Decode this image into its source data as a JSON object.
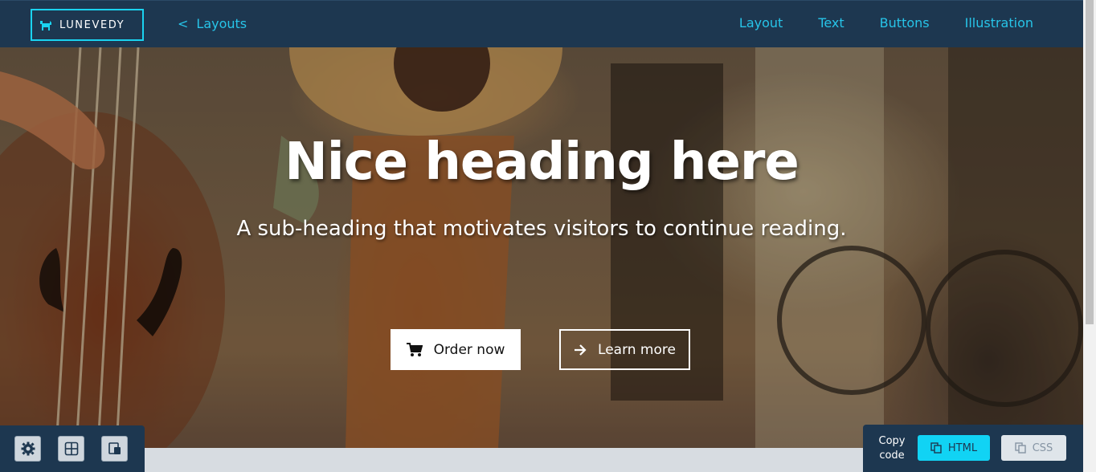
{
  "brand": {
    "name": "LUNEVEDY",
    "logo_icon": "dog-logo-icon"
  },
  "back_link": {
    "chevron": "<",
    "label": "Layouts"
  },
  "nav": {
    "items": [
      "Layout",
      "Text",
      "Buttons",
      "Illustration"
    ]
  },
  "hero": {
    "heading": "Nice heading here",
    "subheading": "A sub-heading that motivates visitors to continue reading.",
    "primary_button": {
      "label": "Order now",
      "icon": "cart-icon"
    },
    "secondary_button": {
      "label": "Learn more",
      "icon": "arrow-right-icon"
    }
  },
  "toolbar": {
    "items": [
      "gear-icon",
      "grid-icon",
      "layers-icon"
    ]
  },
  "copy_panel": {
    "label": "Copy code",
    "html_label": "HTML",
    "css_label": "CSS"
  },
  "colors": {
    "accent": "#11d3f4",
    "nav_background": "#1d3750",
    "link": "#27c4e8"
  }
}
